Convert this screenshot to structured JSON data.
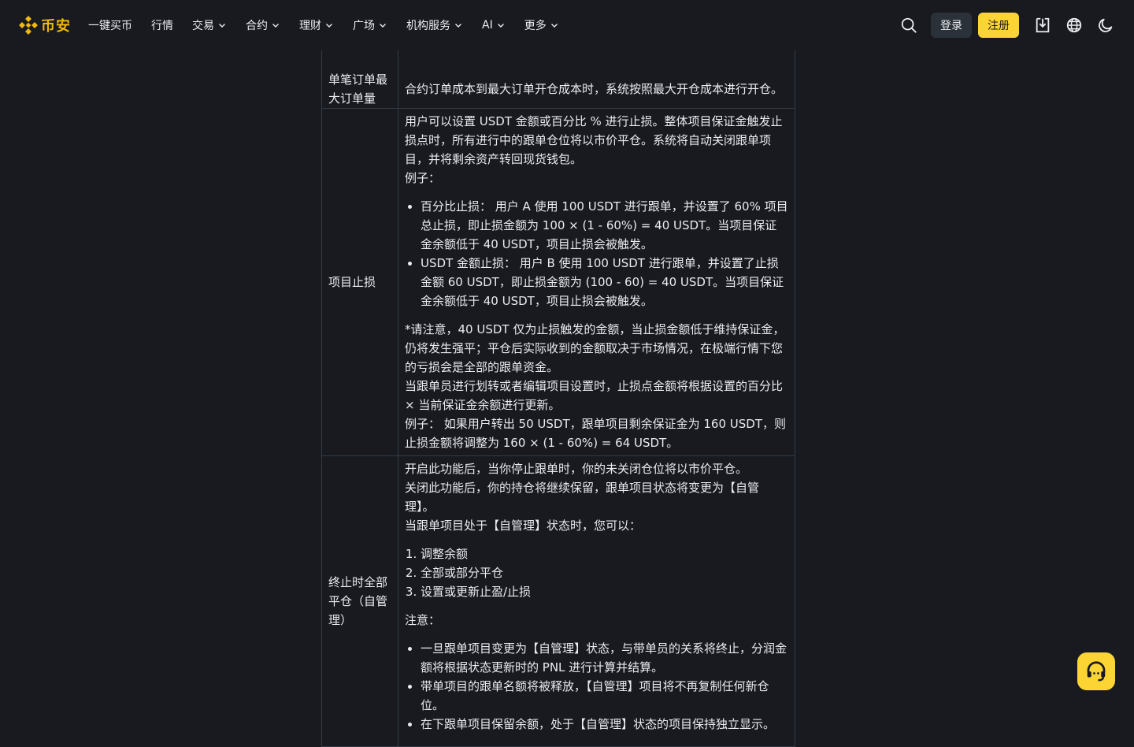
{
  "header": {
    "logo_text": "币安",
    "nav": [
      {
        "label": "一键买币",
        "dropdown": false
      },
      {
        "label": "行情",
        "dropdown": false
      },
      {
        "label": "交易",
        "dropdown": true
      },
      {
        "label": "合约",
        "dropdown": true
      },
      {
        "label": "理财",
        "dropdown": true
      },
      {
        "label": "广场",
        "dropdown": true
      },
      {
        "label": "机构服务",
        "dropdown": true
      },
      {
        "label": "AI",
        "dropdown": true
      },
      {
        "label": "更多",
        "dropdown": true
      }
    ],
    "login_label": "登录",
    "register_label": "注册"
  },
  "table": {
    "row1": {
      "label": "单笔订单最大订单量",
      "text": "合约订单成本到最大订单开仓成本时，系统按照最大开仓成本进行开仓。"
    },
    "row2": {
      "label": "项目止损",
      "p1": "用户可以设置 USDT 金额或百分比 % 进行止损。整体项目保证金触发止损点时，所有进行中的跟单仓位将以市价平仓。系统将自动关闭跟单项目，并将剩余资产转回现货钱包。",
      "p2": "例子：",
      "bullets": [
        "百分比止损： 用户 A 使用 100 USDT 进行跟单，并设置了 60% 项目总止损，即止损金额为 100 × (1 - 60%) = 40 USDT。当项目保证金余额低于 40 USDT，项目止损会被触发。",
        "USDT 金额止损： 用户 B 使用 100 USDT 进行跟单，并设置了止损金额 60 USDT，即止损金额为 (100 - 60) = 40 USDT。当项目保证金余额低于 40 USDT，项目止损会被触发。"
      ],
      "p3": "*请注意，40 USDT 仅为止损触发的金额，当止损金额低于维持保证金，仍将发生强平；平仓后实际收到的金额取决于市场情况，在极端行情下您的亏损会是全部的跟单资金。",
      "p4": "当跟单员进行划转或者编辑项目设置时，止损点金额将根据设置的百分比 × 当前保证金余额进行更新。",
      "p5": "例子： 如果用户转出 50 USDT，跟单项目剩余保证金为 160 USDT，则止损金额将调整为 160 × (1 - 60%) = 64 USDT。"
    },
    "row3": {
      "label": "终止时全部平仓（自管理）",
      "p1": "开启此功能后，当你停止跟单时，你的未关闭仓位将以市价平仓。",
      "p2": "关闭此功能后，你的持仓将继续保留，跟单项目状态将变更为【自管理】。",
      "p3": "当跟单项目处于【自管理】状态时，您可以：",
      "ordered": [
        "调整余额",
        "全部或部分平仓",
        "设置或更新止盈/止损"
      ],
      "p4": "注意：",
      "bullets": [
        "一旦跟单项目变更为【自管理】状态，与带单员的关系将终止，分润金额将根据状态更新时的 PNL 进行计算并结算。",
        "带单项目的跟单名额将被释放，【自管理】项目将不再复制任何新仓位。",
        "在下跟单项目保留余额，处于【自管理】状态的项目保持独立显示。"
      ]
    }
  },
  "colors": {
    "accent": "#f0b90b",
    "button_yellow": "#fcd535",
    "background": "#181a20",
    "border": "#333b47"
  },
  "icons": {
    "logo": "binance-logo-icon",
    "search": "search-icon",
    "download": "download-icon",
    "language": "globe-icon",
    "theme": "moon-icon",
    "support": "headset-icon"
  }
}
